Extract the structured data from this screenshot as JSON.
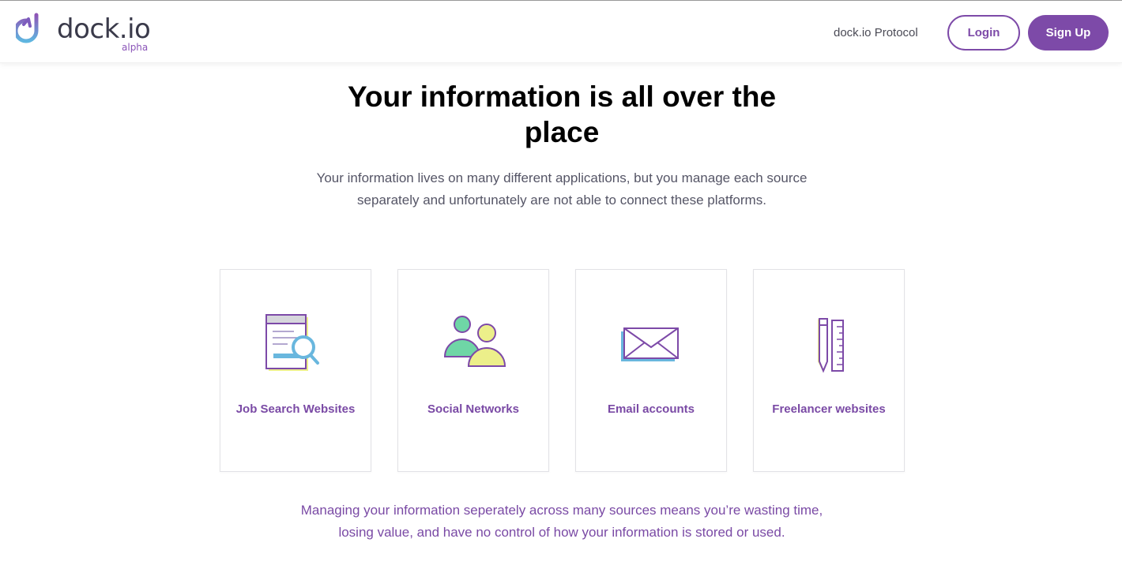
{
  "header": {
    "logo_text": "dock.io",
    "logo_sub": "alpha",
    "nav_link": "dock.io Protocol",
    "login_label": "Login",
    "signup_label": "Sign Up"
  },
  "hero": {
    "title": "Your information is all over the place",
    "description": "Your information lives on many different applications, but you manage each source separately and unfortunately are not able to connect these platforms."
  },
  "cards": [
    {
      "label": "Job Search Websites",
      "icon": "job-search-icon"
    },
    {
      "label": "Social Networks",
      "icon": "social-networks-icon"
    },
    {
      "label": "Email accounts",
      "icon": "email-icon"
    },
    {
      "label": "Freelancer websites",
      "icon": "pencil-ruler-icon"
    }
  ],
  "footer": {
    "text": "Managing your information seperately across many sources means you’re wasting time, losing value, and have no control of how your information is stored or used."
  },
  "colors": {
    "brand": "#7d4aa8",
    "accent_green": "#6fd6a6",
    "accent_yellow": "#ecef8a",
    "accent_blue": "#69b7de"
  }
}
